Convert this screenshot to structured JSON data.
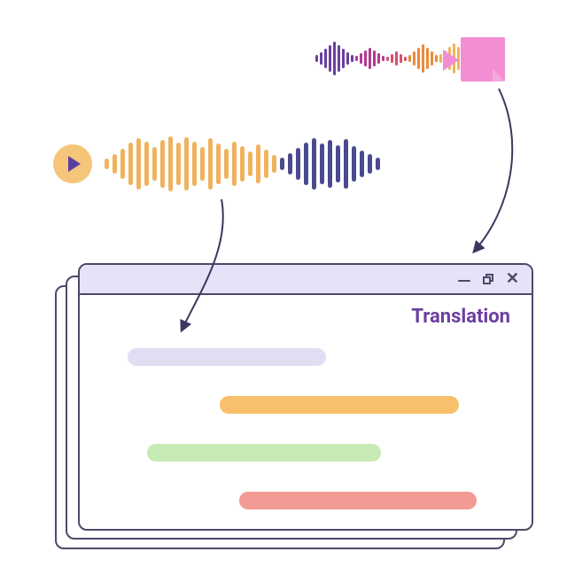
{
  "window": {
    "label": "Translation"
  }
}
